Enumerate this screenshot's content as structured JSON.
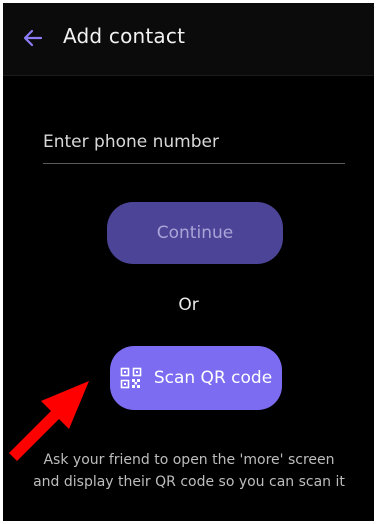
{
  "header": {
    "back_icon": "back-arrow-icon",
    "title": "Add contact"
  },
  "form": {
    "phone_placeholder": "Enter phone number",
    "phone_value": "",
    "continue_label": "Continue",
    "or_label": "Or",
    "scan_icon": "qr-code-icon",
    "scan_label": "Scan QR code",
    "hint": "Ask your friend to open the 'more' screen and display their QR code so you can scan it"
  },
  "annotation": {
    "icon": "red-pointer-arrow-icon",
    "color": "#ff0000"
  },
  "colors": {
    "background": "#000000",
    "accent": "#7c6cf2",
    "accent_disabled": "#4c4497"
  }
}
